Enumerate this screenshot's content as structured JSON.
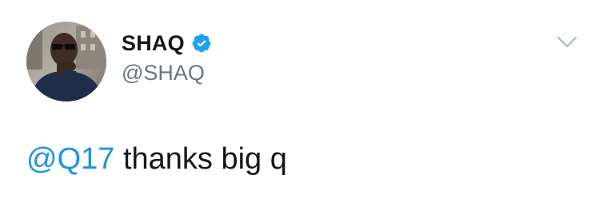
{
  "author": {
    "display_name": "SHAQ",
    "handle": "@SHAQ",
    "verified": true
  },
  "tweet": {
    "mention": "@Q17",
    "text": " thanks big q"
  },
  "icons": {
    "avatar": "profile-photo",
    "verified": "verified-badge-icon",
    "more": "chevron-down-icon"
  },
  "colors": {
    "mention": "#1b95e0",
    "verified": "#1da1f2",
    "name": "#14171a",
    "handle": "#657786",
    "caret": "#aab8c2"
  }
}
